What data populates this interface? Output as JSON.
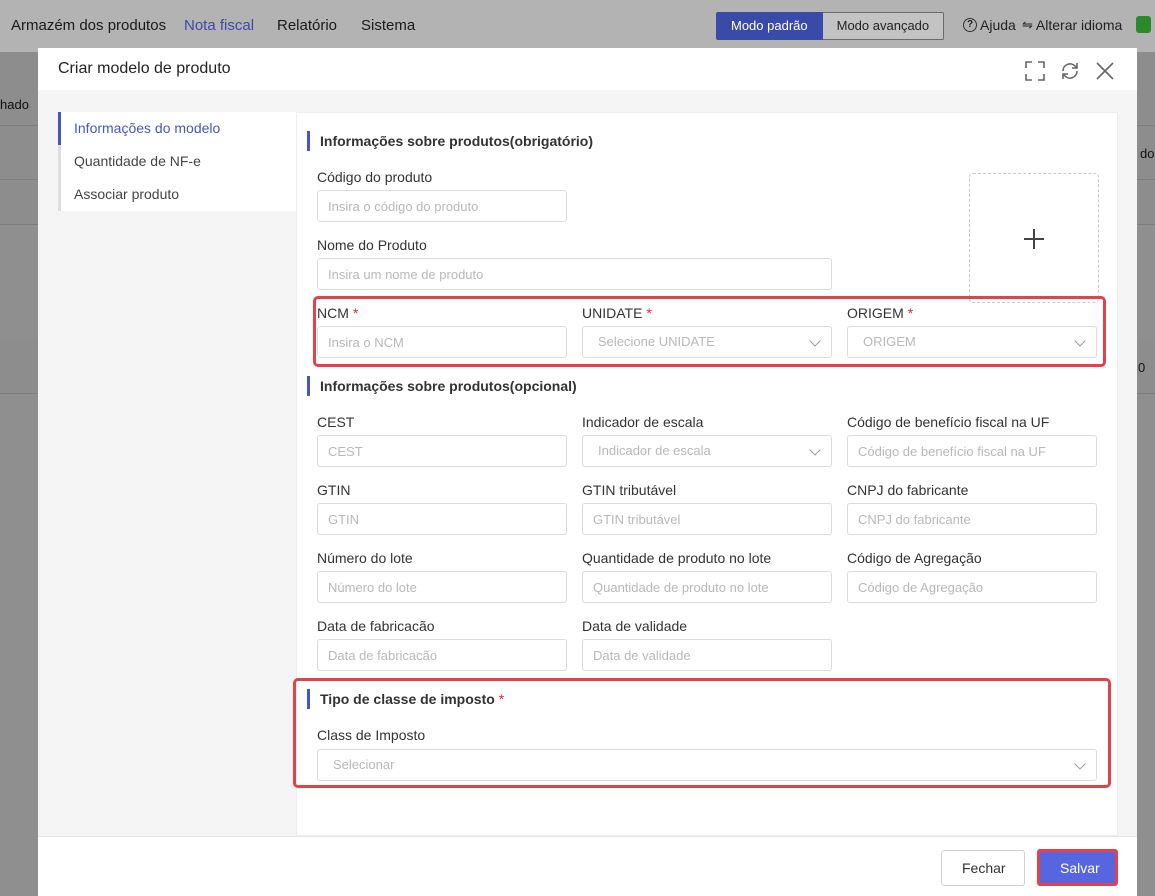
{
  "topbar": {
    "nav": [
      "Armazém dos produtos",
      "Nota fiscal",
      "Relatório",
      "Sistema"
    ],
    "active_index": 1,
    "mode_default": "Modo padrão",
    "mode_advanced": "Modo avançado",
    "help": "Ajuda",
    "change_language": "Alterar idioma"
  },
  "background": {
    "frag_left": "hado",
    "frag_right_1": "do",
    "frag_right_2": "0"
  },
  "modal": {
    "title": "Criar modelo de produto",
    "side_tabs": [
      "Informações do modelo",
      "Quantidade de NF-e",
      "Associar produto"
    ],
    "active_tab": 0,
    "section_required": {
      "title": "Informações sobre produtos(obrigatório)",
      "product_code": {
        "label": "Código do produto",
        "placeholder": "Insira o código do produto"
      },
      "product_name": {
        "label": "Nome do Produto",
        "placeholder": "Insira um nome de produto"
      },
      "ncm": {
        "label": "NCM",
        "placeholder": "Insira o NCM",
        "required_mark": "*"
      },
      "unit": {
        "label": "UNIDATE",
        "placeholder": "Selecione UNIDATE",
        "required_mark": "*"
      },
      "origin": {
        "label": "ORIGEM",
        "placeholder": "ORIGEM",
        "required_mark": "*"
      }
    },
    "section_optional": {
      "title": "Informações sobre produtos(opcional)",
      "fields": [
        {
          "label": "CEST",
          "placeholder": "CEST"
        },
        {
          "label": "Indicador de escala",
          "placeholder": "Indicador de escala"
        },
        {
          "label": "Código de benefício fiscal na UF",
          "placeholder": "Código de benefício fiscal na UF"
        },
        {
          "label": "GTIN",
          "placeholder": "GTIN"
        },
        {
          "label": "GTIN tributável",
          "placeholder": "GTIN tributável"
        },
        {
          "label": "CNPJ do fabricante",
          "placeholder": "CNPJ do fabricante"
        },
        {
          "label": "Número do lote",
          "placeholder": "Número do lote"
        },
        {
          "label": "Quantidade de produto no lote",
          "placeholder": "Quantidade de produto no lote"
        },
        {
          "label": "Código de Agregação",
          "placeholder": "Código de Agregação"
        },
        {
          "label": "Data de fabricacão",
          "placeholder": "Data de fabricacão"
        },
        {
          "label": "Data de validade",
          "placeholder": "Data de validade"
        }
      ]
    },
    "section_tax": {
      "title": "Tipo de classe de imposto",
      "required_mark": "*",
      "label": "Class de Imposto",
      "placeholder": "Selecionar"
    },
    "footer": {
      "close_label": "Fechar",
      "save_label": "Salvar"
    }
  },
  "colors": {
    "accent": "#4457c2",
    "highlight": "#e0444a",
    "save": "#5865e0"
  }
}
